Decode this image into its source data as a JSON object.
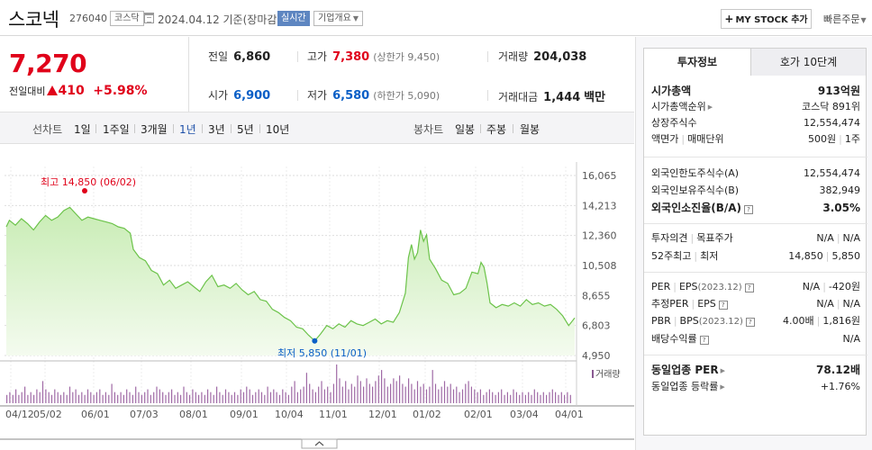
{
  "header": {
    "name": "스코넥",
    "code": "276040",
    "market": "코스닥",
    "date_text": "2024.04.12  기준(장마감)",
    "realtime": "실시간",
    "overview": "기업개요",
    "mystock": "MY STOCK 추가",
    "mystock_plus": "+",
    "quick_order": "빠른주문"
  },
  "price": {
    "current": "7,270",
    "change_label": "전일대비",
    "change": "410",
    "change_pct": "+5.98%"
  },
  "ohlc": {
    "prev_label": "전일",
    "prev": "6,860",
    "high_label": "고가",
    "high": "7,380",
    "upper_limit": "(상한가 9,450)",
    "volume_label": "거래량",
    "volume": "204,038",
    "open_label": "시가",
    "open": "6,900",
    "low_label": "저가",
    "low": "6,580",
    "lower_limit": "(하한가 5,090)",
    "amount_label": "거래대금",
    "amount": "1,444",
    "amount_unit": "백만"
  },
  "period_tabs": {
    "line_label": "선차트",
    "line": [
      "1일",
      "1주일",
      "3개월",
      "1년",
      "3년",
      "5년",
      "10년"
    ],
    "selected": "1년",
    "candle_label": "봉차트",
    "candle": [
      "일봉",
      "주봉",
      "월봉"
    ]
  },
  "panel": {
    "tab_active": "투자정보",
    "tab_inactive": "호가 10단계",
    "rows": {
      "mktcap_k": "시가총액",
      "mktcap_v": "913억원",
      "mktcap_rank_k": "시가총액순위",
      "mktcap_rank_v": "코스닥 891위",
      "shares_k": "상장주식수",
      "shares_v": "12,554,474",
      "par_k": "액면가",
      "par_k2": "매매단위",
      "par_v": "500원",
      "par_v2": "1주",
      "for_limit_k": "외국인한도주식수(A)",
      "for_limit_v": "12,554,474",
      "for_hold_k": "외국인보유주식수(B)",
      "for_hold_v": "382,949",
      "for_ratio_k": "외국인소진율(B/A)",
      "for_ratio_v": "3.05%",
      "opinion_k": "투자의견",
      "opinion_k2": "목표주가",
      "opinion_v": "N/A",
      "opinion_v2": "N/A",
      "w52_k": "52주최고",
      "w52_k2": "최저",
      "w52_v": "14,850",
      "w52_v2": "5,850",
      "per_k": "PER",
      "per_k2": "EPS",
      "per_year": "(2023.12)",
      "per_v": "N/A",
      "per_v2": "-420원",
      "eper_k": "추정PER",
      "eper_k2": "EPS",
      "eper_v": "N/A",
      "eper_v2": "N/A",
      "pbr_k": "PBR",
      "pbr_k2": "BPS",
      "pbr_year": "(2023.12)",
      "pbr_v": "4.00배",
      "pbr_v2": "1,816원",
      "div_k": "배당수익률",
      "div_v": "N/A",
      "sector_per_k": "동일업종 PER",
      "sector_per_v": "78.12배",
      "sector_rate_k": "동일업종 등락률",
      "sector_rate_v": "+1.76%"
    },
    "q": "?"
  },
  "chart_data": {
    "type": "area",
    "y_ticks": [
      "16,065",
      "14,213",
      "12,360",
      "10,508",
      "8,655",
      "6,803",
      "4,950"
    ],
    "ylim": [
      4950,
      16065
    ],
    "x_ticks": [
      "04/12",
      "05/02",
      "06/01",
      "07/03",
      "08/01",
      "09/01",
      "10/04",
      "11/01",
      "12/01",
      "01/02",
      "02/01",
      "03/04",
      "04/01"
    ],
    "max_label": "최고 14,850 (06/02)",
    "min_label": "최저 5,850 (11/01)",
    "volume_legend": "거래량",
    "color": "#6cc34a",
    "series": [
      {
        "x": 0,
        "y": 12900
      },
      {
        "x": 1,
        "y": 13300
      },
      {
        "x": 3,
        "y": 13000
      },
      {
        "x": 5,
        "y": 13400
      },
      {
        "x": 7,
        "y": 13100
      },
      {
        "x": 9,
        "y": 12700
      },
      {
        "x": 11,
        "y": 13200
      },
      {
        "x": 13,
        "y": 13600
      },
      {
        "x": 15,
        "y": 13300
      },
      {
        "x": 17,
        "y": 13500
      },
      {
        "x": 19,
        "y": 13900
      },
      {
        "x": 21,
        "y": 14100
      },
      {
        "x": 23,
        "y": 13700
      },
      {
        "x": 25,
        "y": 13300
      },
      {
        "x": 27,
        "y": 13500
      },
      {
        "x": 29,
        "y": 13400
      },
      {
        "x": 31,
        "y": 13300
      },
      {
        "x": 33,
        "y": 13200
      },
      {
        "x": 35,
        "y": 13100
      },
      {
        "x": 37,
        "y": 12900
      },
      {
        "x": 39,
        "y": 12800
      },
      {
        "x": 41,
        "y": 12500
      },
      {
        "x": 42,
        "y": 11500
      },
      {
        "x": 44,
        "y": 11000
      },
      {
        "x": 46,
        "y": 10800
      },
      {
        "x": 48,
        "y": 10200
      },
      {
        "x": 50,
        "y": 10000
      },
      {
        "x": 52,
        "y": 9300
      },
      {
        "x": 54,
        "y": 9600
      },
      {
        "x": 56,
        "y": 9100
      },
      {
        "x": 58,
        "y": 9300
      },
      {
        "x": 60,
        "y": 9500
      },
      {
        "x": 62,
        "y": 9200
      },
      {
        "x": 64,
        "y": 8900
      },
      {
        "x": 66,
        "y": 9500
      },
      {
        "x": 68,
        "y": 9900
      },
      {
        "x": 70,
        "y": 9200
      },
      {
        "x": 72,
        "y": 9300
      },
      {
        "x": 74,
        "y": 9100
      },
      {
        "x": 76,
        "y": 9400
      },
      {
        "x": 78,
        "y": 9000
      },
      {
        "x": 80,
        "y": 8700
      },
      {
        "x": 82,
        "y": 8900
      },
      {
        "x": 84,
        "y": 8400
      },
      {
        "x": 86,
        "y": 8300
      },
      {
        "x": 88,
        "y": 7800
      },
      {
        "x": 90,
        "y": 7600
      },
      {
        "x": 92,
        "y": 7300
      },
      {
        "x": 94,
        "y": 7100
      },
      {
        "x": 96,
        "y": 6700
      },
      {
        "x": 98,
        "y": 6600
      },
      {
        "x": 100,
        "y": 6200
      },
      {
        "x": 102,
        "y": 5850
      },
      {
        "x": 104,
        "y": 6300
      },
      {
        "x": 106,
        "y": 6800
      },
      {
        "x": 108,
        "y": 6600
      },
      {
        "x": 110,
        "y": 6900
      },
      {
        "x": 112,
        "y": 6700
      },
      {
        "x": 114,
        "y": 7100
      },
      {
        "x": 116,
        "y": 6900
      },
      {
        "x": 118,
        "y": 6800
      },
      {
        "x": 120,
        "y": 7000
      },
      {
        "x": 122,
        "y": 7200
      },
      {
        "x": 124,
        "y": 6900
      },
      {
        "x": 126,
        "y": 7100
      },
      {
        "x": 128,
        "y": 7000
      },
      {
        "x": 130,
        "y": 7600
      },
      {
        "x": 132,
        "y": 8800
      },
      {
        "x": 133,
        "y": 11000
      },
      {
        "x": 134,
        "y": 11800
      },
      {
        "x": 135,
        "y": 10900
      },
      {
        "x": 136,
        "y": 11300
      },
      {
        "x": 137,
        "y": 12700
      },
      {
        "x": 138,
        "y": 12000
      },
      {
        "x": 139,
        "y": 12400
      },
      {
        "x": 140,
        "y": 10900
      },
      {
        "x": 142,
        "y": 10300
      },
      {
        "x": 144,
        "y": 9600
      },
      {
        "x": 146,
        "y": 9400
      },
      {
        "x": 148,
        "y": 8700
      },
      {
        "x": 150,
        "y": 8800
      },
      {
        "x": 152,
        "y": 9100
      },
      {
        "x": 154,
        "y": 10100
      },
      {
        "x": 156,
        "y": 10000
      },
      {
        "x": 157,
        "y": 10700
      },
      {
        "x": 158,
        "y": 10400
      },
      {
        "x": 159,
        "y": 9400
      },
      {
        "x": 160,
        "y": 8200
      },
      {
        "x": 162,
        "y": 7900
      },
      {
        "x": 164,
        "y": 8100
      },
      {
        "x": 166,
        "y": 8000
      },
      {
        "x": 168,
        "y": 8200
      },
      {
        "x": 170,
        "y": 8000
      },
      {
        "x": 172,
        "y": 8400
      },
      {
        "x": 174,
        "y": 8100
      },
      {
        "x": 176,
        "y": 8200
      },
      {
        "x": 178,
        "y": 8000
      },
      {
        "x": 180,
        "y": 8100
      },
      {
        "x": 182,
        "y": 7800
      },
      {
        "x": 184,
        "y": 7400
      },
      {
        "x": 186,
        "y": 6800
      },
      {
        "x": 188,
        "y": 7270
      }
    ],
    "volume": [
      3,
      4,
      3,
      5,
      3,
      4,
      6,
      3,
      4,
      3,
      5,
      4,
      8,
      5,
      4,
      3,
      5,
      4,
      3,
      4,
      3,
      6,
      4,
      5,
      3,
      4,
      3,
      5,
      4,
      3,
      4,
      5,
      3,
      4,
      3,
      7,
      4,
      3,
      4,
      3,
      5,
      4,
      3,
      6,
      4,
      3,
      4,
      5,
      3,
      4,
      6,
      5,
      4,
      3,
      4,
      5,
      3,
      4,
      3,
      6,
      4,
      3,
      5,
      4,
      3,
      4,
      3,
      5,
      4,
      3,
      6,
      4,
      3,
      5,
      4,
      3,
      4,
      3,
      5,
      4,
      6,
      5,
      3,
      4,
      5,
      4,
      3,
      6,
      4,
      5,
      4,
      3,
      5,
      4,
      3,
      6,
      8,
      4,
      5,
      6,
      11,
      7,
      5,
      4,
      6,
      8,
      5,
      6,
      4,
      7,
      14,
      9,
      6,
      8,
      5,
      7,
      6,
      10,
      8,
      6,
      9,
      7,
      6,
      8,
      10,
      12,
      9,
      6,
      7,
      9,
      8,
      10,
      7,
      6,
      9,
      7,
      5,
      8,
      6,
      7,
      5,
      6,
      12,
      7,
      5,
      6,
      8,
      6,
      7,
      5,
      6,
      4,
      5,
      7,
      8,
      6,
      5,
      4,
      5,
      3,
      4,
      5,
      4,
      3,
      4,
      5,
      3,
      4,
      3,
      5,
      4,
      3,
      4,
      3,
      4,
      3,
      5,
      4,
      3,
      4,
      3,
      4,
      5,
      4,
      3,
      4,
      3,
      4,
      3
    ]
  }
}
